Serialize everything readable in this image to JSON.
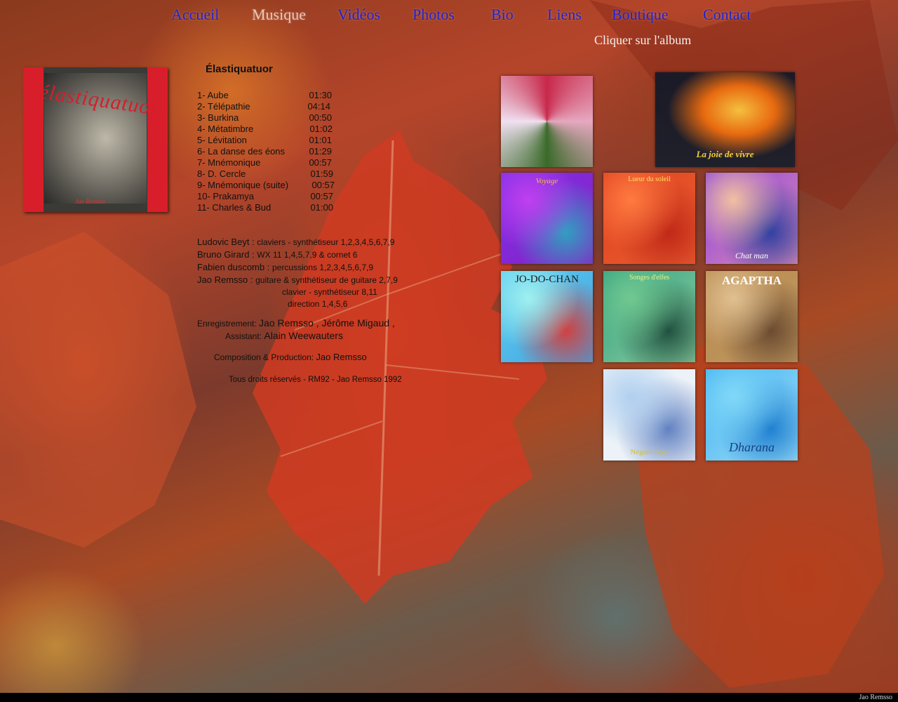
{
  "nav": [
    {
      "label": "Accueil",
      "active": false
    },
    {
      "label": "Musique",
      "active": true
    },
    {
      "label": "Vidéos",
      "active": false
    },
    {
      "label": "Photos",
      "active": false
    },
    {
      "label": "Bio",
      "active": false
    },
    {
      "label": "Liens",
      "active": false
    },
    {
      "label": "Boutique",
      "active": false
    },
    {
      "label": "Contact",
      "active": false
    }
  ],
  "hint": "Cliquer sur l'album",
  "cover": {
    "title": "élastiquatuor",
    "artist": "Jao Remsso"
  },
  "album_title": "Élastiquatuor",
  "tracks": [
    {
      "n": "1-  Aube",
      "t": "01:30"
    },
    {
      "n": "2-  Télépathie",
      "t": "04:14"
    },
    {
      "n": "3-  Burkina",
      "t": "00:50"
    },
    {
      "n": "4-  Métatimbre",
      "t": "01:02"
    },
    {
      "n": "5-  Lévitation",
      "t": "01:01"
    },
    {
      "n": "6-  La danse des éons",
      "t": "01:29"
    },
    {
      "n": "7-  Mnémonique",
      "t": "00:57"
    },
    {
      "n": "8-  D. Cercle",
      "t": "01:59"
    },
    {
      "n": "9-  Mnémonique (suite)",
      "t": "00:57"
    },
    {
      "n": "10- Prakamya",
      "t": "00:57"
    },
    {
      "n": "11- Charles & Bud",
      "t": "01:00"
    }
  ],
  "credits": [
    {
      "name": "Ludovic Beyt :",
      "role": "claviers - synthétiseur 1,2,3,4,5,6,7,9"
    },
    {
      "name": "Bruno Girard :",
      "role": "WX 11  1,4,5,7,9 & cornet 6"
    },
    {
      "name": "Fabien duscomb :",
      "role": "percussions 1,2,3,4,5,6,7,9"
    },
    {
      "name": "Jao Remsso :",
      "role": "guitare & synthétiseur de guitare 2,7,9"
    }
  ],
  "credits_extra": [
    "clavier - synthétiseur 8,11",
    "direction 1,4,5,6"
  ],
  "recording": {
    "label": "Enregistrement:",
    "names": "Jao Remsso , Jérôme Migaud ,",
    "assistant_label": "Assistant:",
    "assistant": "Alain Weewauters"
  },
  "composition": {
    "label": "Composition & Production:",
    "name": "Jao Remsso"
  },
  "rights": "Tous droits réservés - RM92 - Jao Remsso 1992",
  "albums": [
    {
      "label": "",
      "colors": [
        "#c8284a",
        "#e6a8c0",
        "#3a6a2a",
        "#f0e0f0"
      ]
    },
    {
      "label": "La joie de vivre",
      "colors": [
        "#1a1a28",
        "#e86a10",
        "#f4c040",
        "#20202a"
      ]
    },
    {
      "label": "Voyage",
      "colors": [
        "#7a30e8",
        "#c040f0",
        "#30a0c0",
        "#8a20c0"
      ]
    },
    {
      "label": "Lueur du soleil",
      "colors": [
        "#e04020",
        "#ff7a40",
        "#c02818",
        "#e86030"
      ]
    },
    {
      "label": "Chat man",
      "colors": [
        "#8a40e0",
        "#f0c0a0",
        "#3040a0",
        "#e090b0"
      ]
    },
    {
      "label": "JO-DO-CHAN",
      "colors": [
        "#60d0f0",
        "#a0f0f0",
        "#d04040",
        "#40a0e0"
      ]
    },
    {
      "label": "Songes d'elfes",
      "colors": [
        "#30a080",
        "#70c890",
        "#205040",
        "#90d0a0"
      ]
    },
    {
      "label": "AGAPTHA",
      "colors": [
        "#b88a50",
        "#e0c090",
        "#6a4a30",
        "#c09860"
      ]
    },
    {
      "label": "Négentropie",
      "colors": [
        "#e8f0f8",
        "#b0d0f0",
        "#6080c0",
        "#f0f4f8"
      ]
    },
    {
      "label": "Dharana",
      "colors": [
        "#40b0f0",
        "#80d8f8",
        "#2080d0",
        "#a0e0f8"
      ]
    }
  ],
  "footer": "Jao Remsso"
}
